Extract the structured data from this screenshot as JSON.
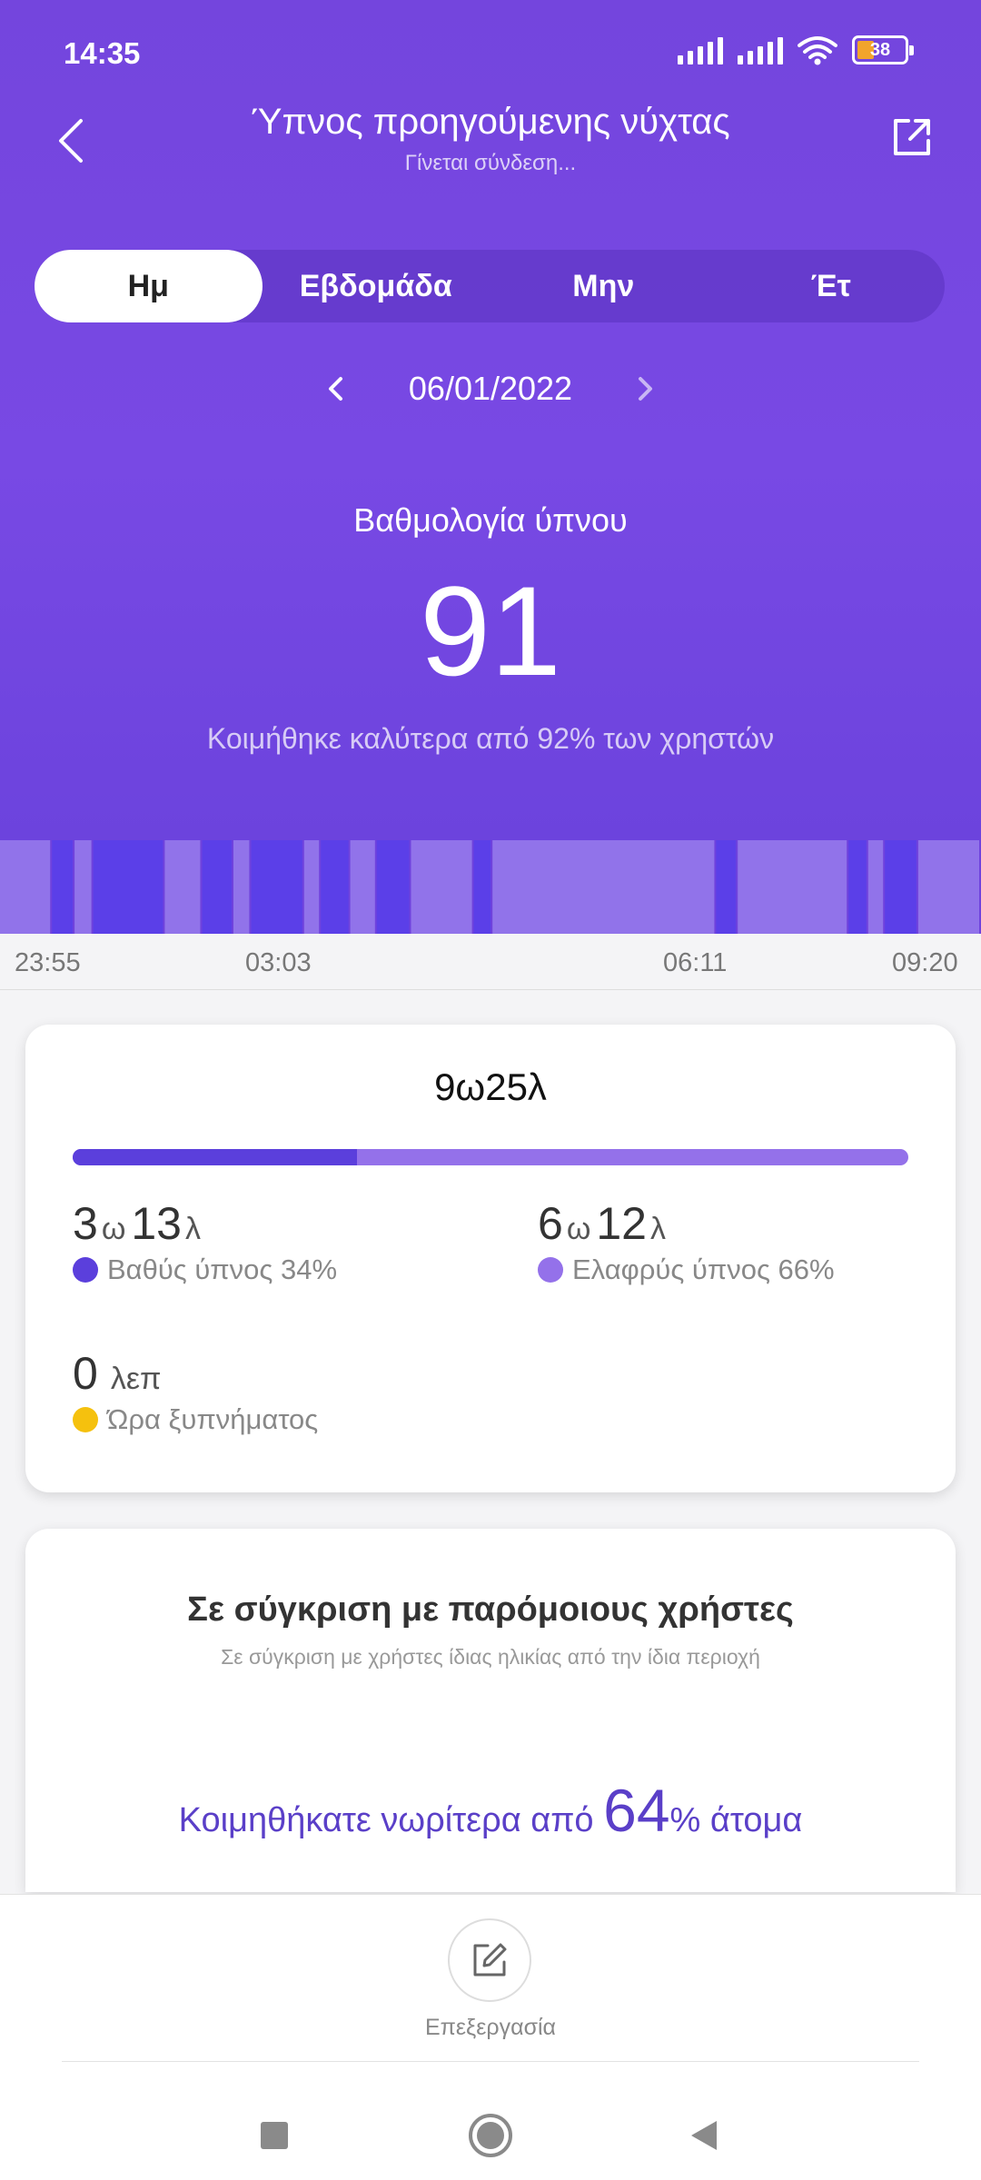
{
  "status_bar": {
    "time": "14:35",
    "battery": "38"
  },
  "header": {
    "title": "Ύπνος προηγούμενης νύχτας",
    "subtitle": "Γίνεται σύνδεση..."
  },
  "tabs": [
    {
      "label": "Ημ",
      "active": true
    },
    {
      "label": "Εβδομάδα",
      "active": false
    },
    {
      "label": "Μην",
      "active": false
    },
    {
      "label": "Έτ",
      "active": false
    }
  ],
  "date_nav": {
    "date": "06/01/2022"
  },
  "score": {
    "label": "Βαθμολογία ύπνου",
    "value": "91",
    "comparison": "Κοιμήθηκε καλύτερα από 92% των χρηστών"
  },
  "timeline": {
    "ticks": [
      "23:55",
      "03:03",
      "06:11",
      "09:20"
    ],
    "colors": {
      "deep": "#5b3fe8",
      "light": "#9173ea"
    },
    "segments": [
      {
        "type": "light",
        "start": 0.0,
        "end": 0.053
      },
      {
        "type": "deep",
        "start": 0.053,
        "end": 0.076
      },
      {
        "type": "light",
        "start": 0.076,
        "end": 0.095
      },
      {
        "type": "deep",
        "start": 0.095,
        "end": 0.168
      },
      {
        "type": "light",
        "start": 0.168,
        "end": 0.206
      },
      {
        "type": "deep",
        "start": 0.206,
        "end": 0.238
      },
      {
        "type": "light",
        "start": 0.238,
        "end": 0.256
      },
      {
        "type": "deep",
        "start": 0.256,
        "end": 0.31
      },
      {
        "type": "light",
        "start": 0.31,
        "end": 0.327
      },
      {
        "type": "deep",
        "start": 0.327,
        "end": 0.357
      },
      {
        "type": "light",
        "start": 0.357,
        "end": 0.384
      },
      {
        "type": "deep",
        "start": 0.384,
        "end": 0.419
      },
      {
        "type": "light",
        "start": 0.419,
        "end": 0.483
      },
      {
        "type": "deep",
        "start": 0.483,
        "end": 0.502
      },
      {
        "type": "light",
        "start": 0.502,
        "end": 0.73
      },
      {
        "type": "deep",
        "start": 0.73,
        "end": 0.752
      },
      {
        "type": "light",
        "start": 0.752,
        "end": 0.865
      },
      {
        "type": "deep",
        "start": 0.865,
        "end": 0.885
      },
      {
        "type": "light",
        "start": 0.885,
        "end": 0.902
      },
      {
        "type": "deep",
        "start": 0.902,
        "end": 0.936
      },
      {
        "type": "light",
        "start": 0.936,
        "end": 1.0
      }
    ]
  },
  "summary": {
    "total": "9ω25λ",
    "deep_fraction": 0.34,
    "deep": {
      "hours": "3",
      "h_unit": "ω",
      "minutes": "13",
      "m_unit": "λ",
      "label": "Βαθύς ύπνος 34%",
      "color": "#5b3fdc"
    },
    "light": {
      "hours": "6",
      "h_unit": "ω",
      "minutes": "12",
      "m_unit": "λ",
      "label": "Ελαφρύς ύπνος 66%",
      "color": "#9471ea"
    },
    "awake": {
      "value": "0",
      "unit": "λεπ",
      "label": "Ώρα ξυπνήματος",
      "color": "#f5c10e"
    }
  },
  "comparison_card": {
    "title": "Σε σύγκριση με παρόμοιους χρήστες",
    "subtitle": "Σε σύγκριση με χρήστες ίδιας ηλικίας από την ίδια περιοχή",
    "prefix": "Κοιμηθήκατε νωρίτερα από",
    "percent": "64",
    "suffix": "% άτομα"
  },
  "bottom": {
    "edit_label": "Επεξεργασία"
  }
}
